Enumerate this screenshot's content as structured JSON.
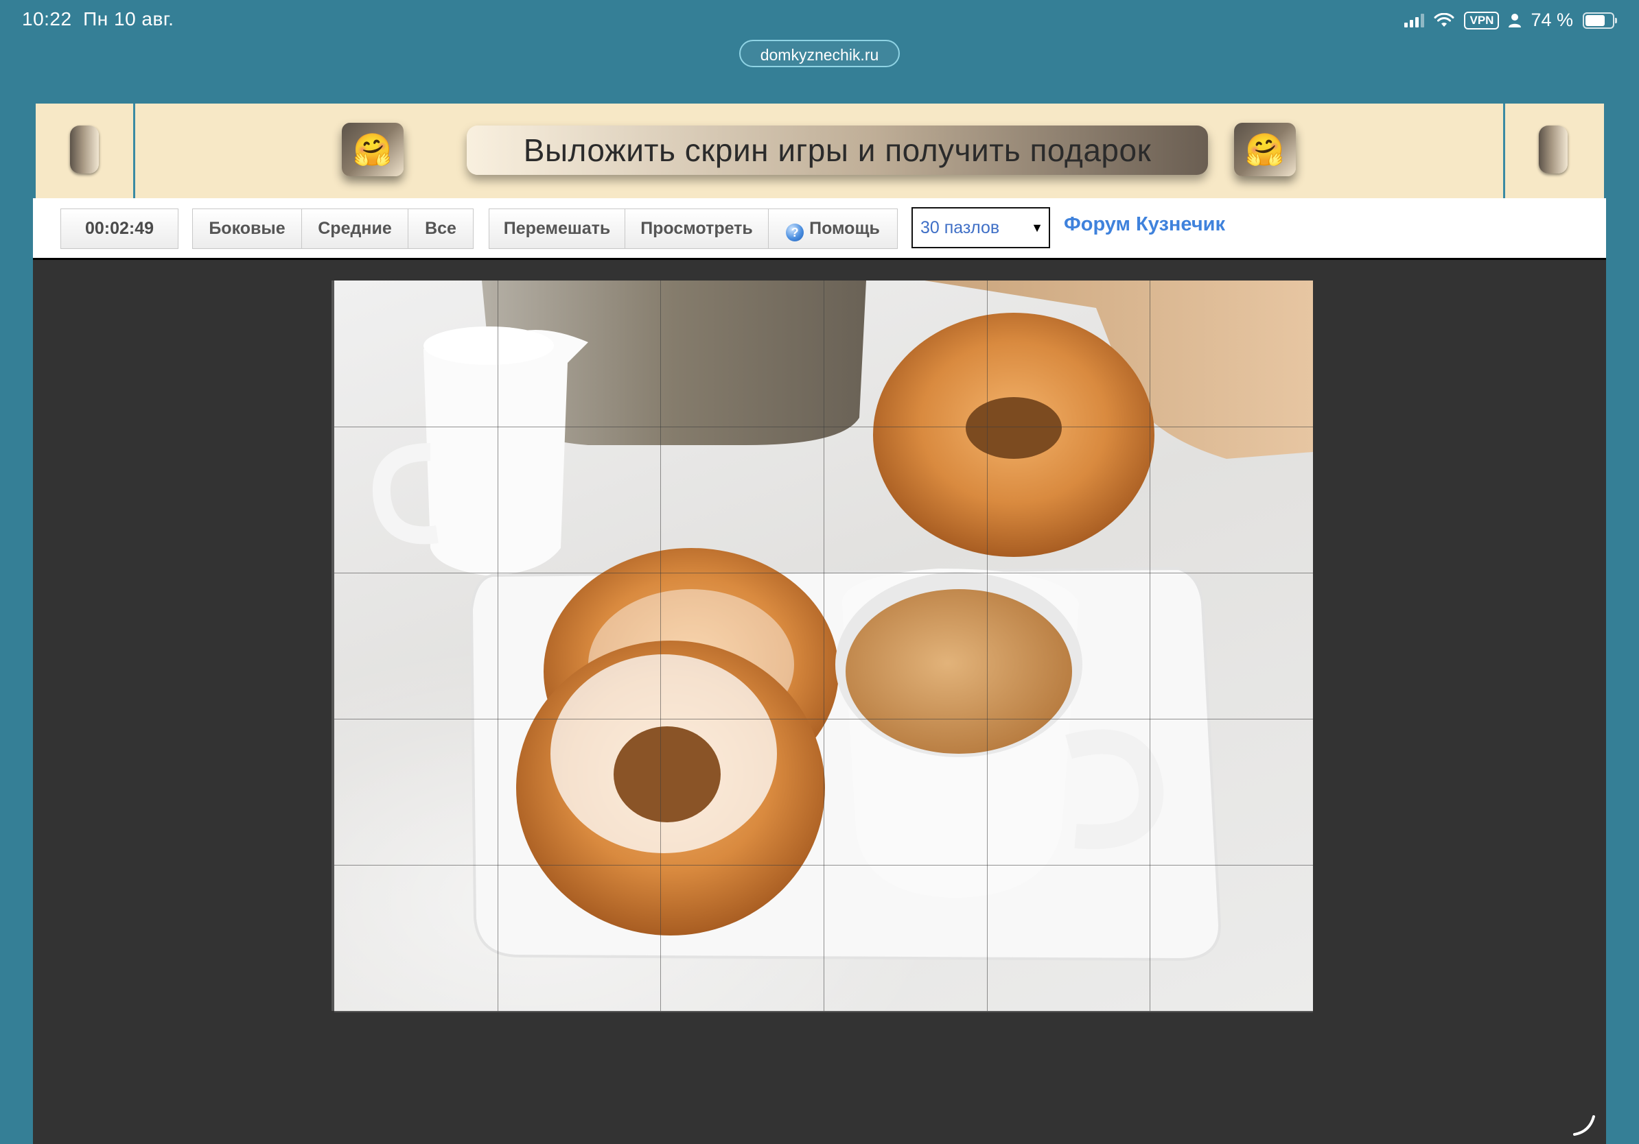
{
  "status_bar": {
    "time": "10:22",
    "date": "Пн 10 авг.",
    "vpn_label": "VPN",
    "battery": "74 %",
    "battery_level_percent": 74
  },
  "browser": {
    "url": "domkyznechik.ru"
  },
  "banner": {
    "promo_text": "Выложить скрин игры и получить подарок",
    "emoji": "🤗"
  },
  "toolbar": {
    "timer": "00:02:49",
    "buttons": {
      "side": "Боковые",
      "middle": "Средние",
      "all": "Все",
      "shuffle": "Перемешать",
      "preview": "Просмотреть",
      "help": "Помощь"
    },
    "puzzle_count_select": {
      "selected": "30 пазлов",
      "arrow": "▼"
    },
    "forum_link": "Форум Кузнечик"
  },
  "puzzle": {
    "columns": 6,
    "rows": 5
  },
  "colors": {
    "page_background": "#357f96",
    "banner_background": "#f7e8c6",
    "game_background": "#333333",
    "link_color": "#3f82dc"
  }
}
